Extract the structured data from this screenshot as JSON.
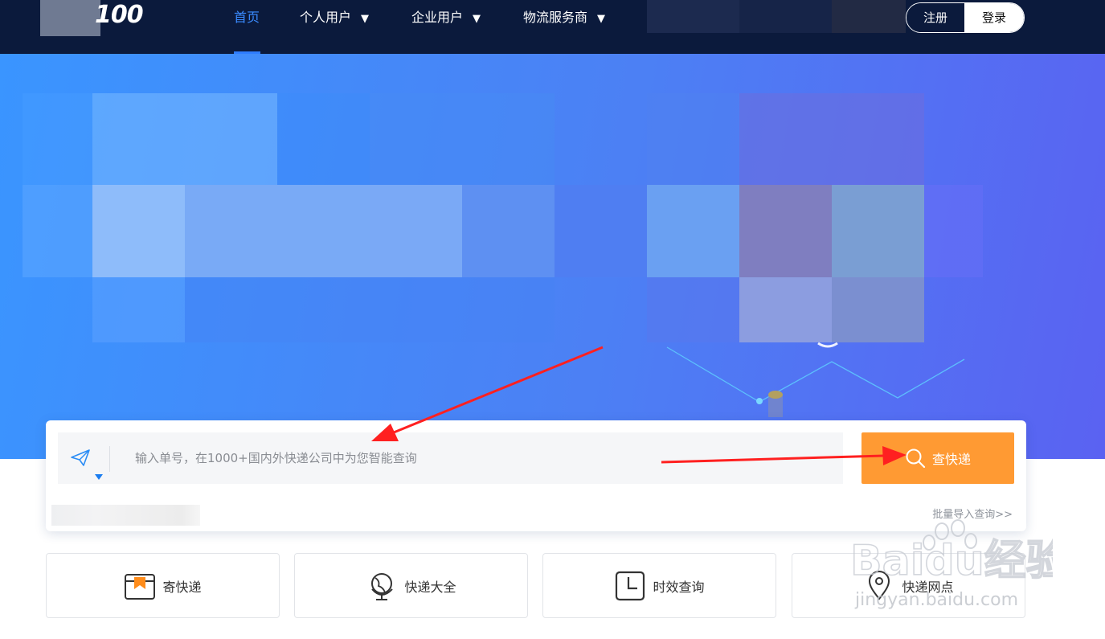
{
  "nav": {
    "logo_text": "100",
    "items": [
      {
        "label": "首页",
        "active": true,
        "dropdown": false
      },
      {
        "label": "个人用户",
        "active": false,
        "dropdown": true
      },
      {
        "label": "企业用户",
        "active": false,
        "dropdown": true
      },
      {
        "label": "物流服务商",
        "active": false,
        "dropdown": true
      }
    ],
    "register_label": "注册",
    "login_label": "登录"
  },
  "search": {
    "placeholder": "输入单号，在1000+国内外快递公司中为您智能查询",
    "button_label": "查快递",
    "batch_link": "批量导入查询>>"
  },
  "services": [
    {
      "label": "寄快递",
      "icon": "package-icon"
    },
    {
      "label": "快递大全",
      "icon": "globe-icon"
    },
    {
      "label": "时效查询",
      "icon": "clock-icon"
    },
    {
      "label": "快递网点",
      "icon": "location-pin-icon"
    }
  ],
  "watermark": {
    "text_main": "Baidu经验",
    "text_sub": "jingyan.baidu.com"
  },
  "colors": {
    "nav_bg": "#0b1a3c",
    "accent_blue": "#2f7dff",
    "search_button": "#ff9a33",
    "annotation_arrow": "#ff2020"
  }
}
